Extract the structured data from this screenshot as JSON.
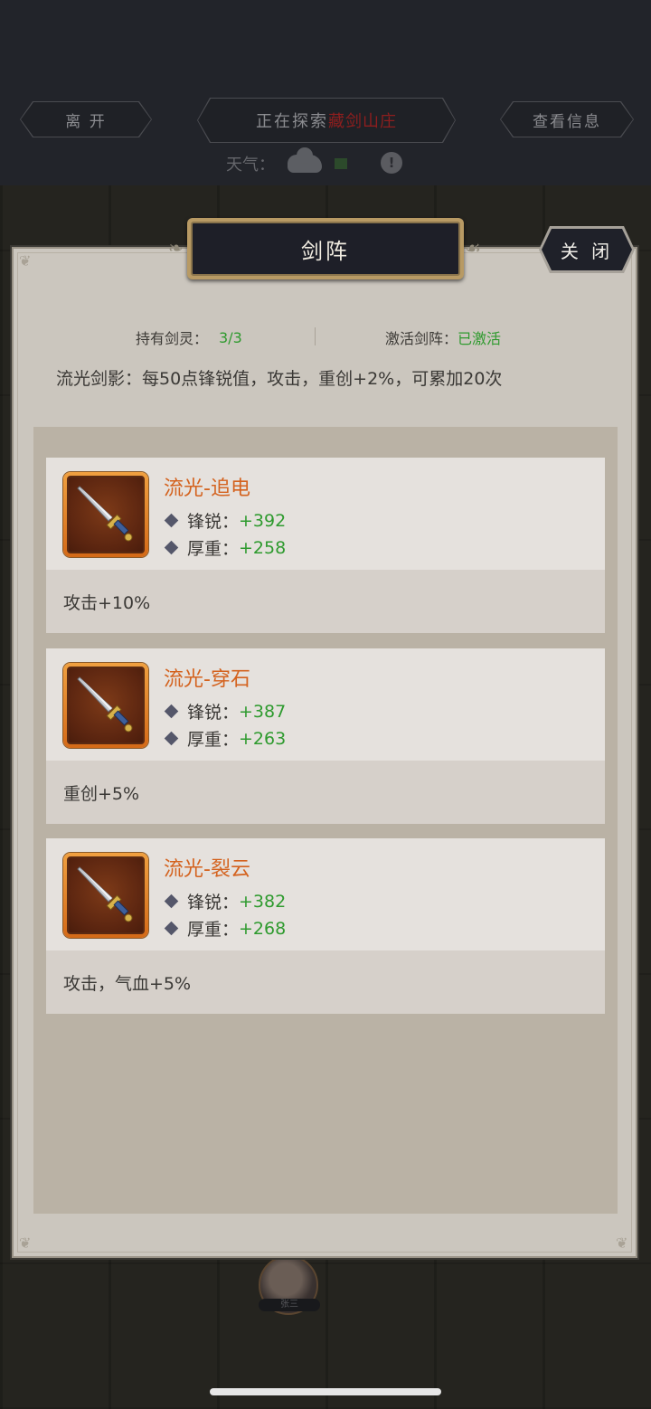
{
  "top_bar": {
    "leave_label": "离 开",
    "exploring_prefix": "正在探索",
    "location": "藏剑山庄",
    "view_info_label": "查看信息",
    "weather_label": "天气："
  },
  "npc": {
    "name": "张三"
  },
  "modal": {
    "title": "剑阵",
    "close_label": "关 闭",
    "held_label": "持有剑灵：",
    "held_value": "3/3",
    "activate_label": "激活剑阵：",
    "activate_value": "已激活",
    "bonus_text": "流光剑影：每50点锋锐值，攻击，重创+2%，可累加20次"
  },
  "swords": [
    {
      "name": "流光-追电",
      "sharp_label": "锋锐：",
      "sharp_value": "+392",
      "weight_label": "厚重：",
      "weight_value": "+258",
      "effect": "攻击+10%",
      "icon": "sword-icon"
    },
    {
      "name": "流光-穿石",
      "sharp_label": "锋锐：",
      "sharp_value": "+387",
      "weight_label": "厚重：",
      "weight_value": "+263",
      "effect": "重创+5%",
      "icon": "sword-icon"
    },
    {
      "name": "流光-裂云",
      "sharp_label": "锋锐：",
      "sharp_value": "+382",
      "weight_label": "厚重：",
      "weight_value": "+268",
      "effect": "攻击，气血+5%",
      "icon": "sword-icon"
    }
  ],
  "colors": {
    "accent_orange": "#d4621e",
    "value_green": "#2e9a2e",
    "panel": "#cbc6be"
  }
}
